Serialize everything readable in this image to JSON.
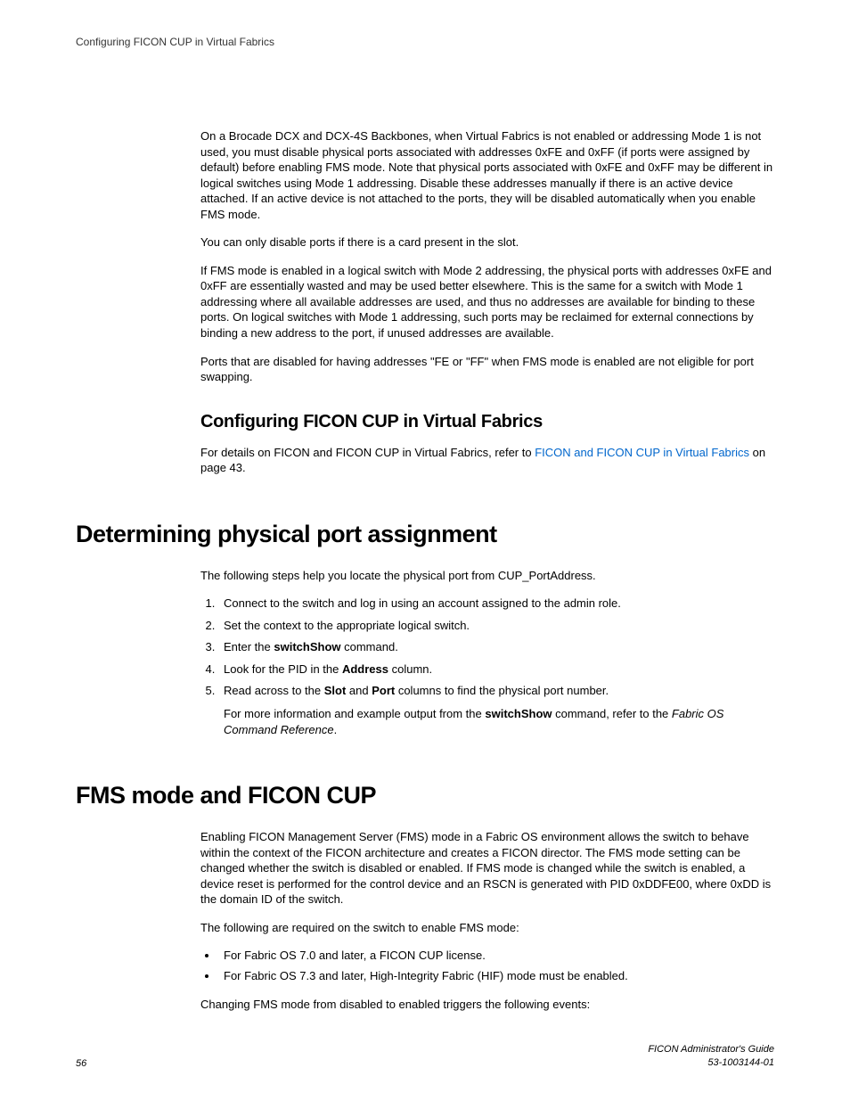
{
  "header": {
    "running_title": "Configuring FICON CUP in Virtual Fabrics"
  },
  "intro": {
    "p1": "On a Brocade DCX and DCX-4S Backbones, when Virtual Fabrics is not enabled or addressing Mode 1 is not used, you must disable physical ports associated with addresses 0xFE and 0xFF (if ports were assigned by default) before enabling FMS mode. Note that physical ports associated with 0xFE and 0xFF may be different in logical switches using Mode 1 addressing. Disable these addresses manually if there is an active device attached. If an active device is not attached to the ports, they will be disabled automatically when you enable FMS mode.",
    "p2": "You can only disable ports if there is a card present in the slot.",
    "p3": "If FMS mode is enabled in a logical switch with Mode 2 addressing, the physical ports with addresses 0xFE and 0xFF are essentially wasted and may be used better elsewhere. This is the same for a switch with Mode 1 addressing where all available addresses are used, and thus no addresses are available for binding to these ports. On logical switches with Mode 1 addressing, such ports may be reclaimed for external connections by binding a new address to the port, if unused addresses are available.",
    "p4": "Ports that are disabled for having addresses \"FE or \"FF\" when FMS mode is enabled are not eligible for port swapping."
  },
  "config_section": {
    "title": "Configuring FICON CUP in Virtual Fabrics",
    "pre_link": "For details on FICON and FICON CUP in Virtual Fabrics, refer to ",
    "link_text": "FICON and FICON CUP in Virtual Fabrics",
    "post_link": " on page 43."
  },
  "determining_section": {
    "title": "Determining physical port assignment",
    "intro": "The following steps help you locate the physical port from CUP_PortAddress.",
    "steps": {
      "s1": "Connect to the switch and log in using an account assigned to the admin role.",
      "s2": "Set the context to the appropriate logical switch.",
      "s3_pre": "Enter the ",
      "s3_cmd": "switchShow",
      "s3_post": " command.",
      "s4_pre": "Look for the PID in the ",
      "s4_b": "Address",
      "s4_post": " column.",
      "s5_pre": "Read across to the ",
      "s5_b1": "Slot",
      "s5_mid": " and ",
      "s5_b2": "Port",
      "s5_post": " columns to find the physical port number.",
      "s5_note_pre": "For more information and example output from the ",
      "s5_note_cmd": "switchShow",
      "s5_note_mid": " command, refer to the ",
      "s5_note_ref": "Fabric OS Command Reference",
      "s5_note_post": "."
    }
  },
  "fms_section": {
    "title": "FMS mode and FICON CUP",
    "p1": "Enabling FICON Management Server (FMS) mode in a Fabric OS environment allows the switch to behave within the context of the FICON architecture and creates a FICON director. The FMS mode setting can be changed whether the switch is disabled or enabled. If FMS mode is changed while the switch is enabled, a device reset is performed for the control device and an RSCN is generated with PID 0xDDFE00, where 0xDD is the domain ID of the switch.",
    "p2": "The following are required on the switch to enable FMS mode:",
    "bullets": {
      "b1": "For Fabric OS 7.0 and later, a FICON CUP license.",
      "b2": "For Fabric OS 7.3 and later, High-Integrity Fabric (HIF) mode must be enabled."
    },
    "p3": "Changing FMS mode from disabled to enabled triggers the following events:"
  },
  "footer": {
    "page_num": "56",
    "doc_title": "FICON Administrator's Guide",
    "doc_id": "53-1003144-01"
  }
}
